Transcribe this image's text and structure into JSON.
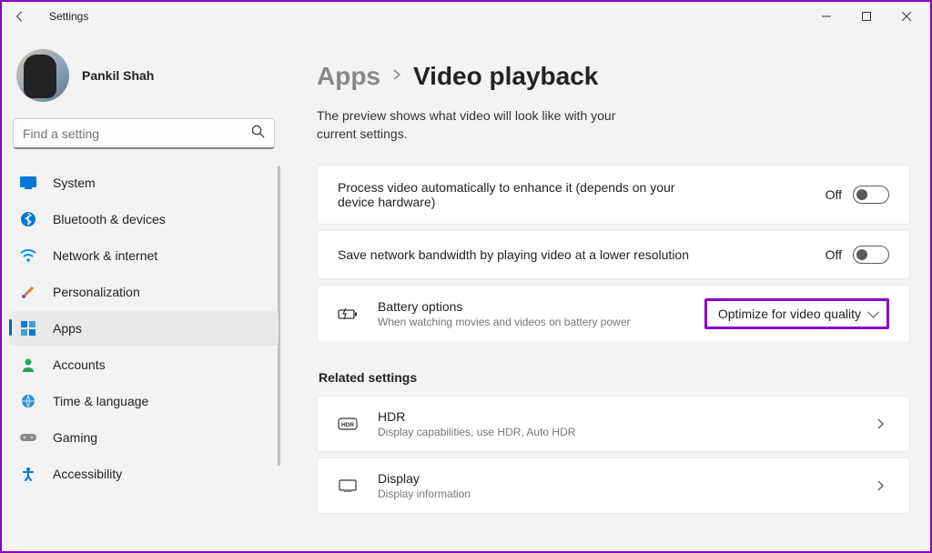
{
  "window": {
    "title": "Settings"
  },
  "profile": {
    "name": "Pankil Shah"
  },
  "search": {
    "placeholder": "Find a setting"
  },
  "nav": {
    "items": [
      {
        "label": "System"
      },
      {
        "label": "Bluetooth & devices"
      },
      {
        "label": "Network & internet"
      },
      {
        "label": "Personalization"
      },
      {
        "label": "Apps"
      },
      {
        "label": "Accounts"
      },
      {
        "label": "Time & language"
      },
      {
        "label": "Gaming"
      },
      {
        "label": "Accessibility"
      }
    ]
  },
  "breadcrumb": {
    "parent": "Apps",
    "current": "Video playback"
  },
  "subtitle": "The preview shows what video will look like with your current settings.",
  "settings": {
    "enhance": {
      "title": "Process video automatically to enhance it (depends on your device hardware)",
      "state": "Off"
    },
    "bandwidth": {
      "title": "Save network bandwidth by playing video at a lower resolution",
      "state": "Off"
    },
    "battery": {
      "title": "Battery options",
      "sub": "When watching movies and videos on battery power",
      "value": "Optimize for video quality"
    }
  },
  "related": {
    "heading": "Related settings",
    "hdr": {
      "title": "HDR",
      "sub": "Display capabilities, use HDR, Auto HDR"
    },
    "display": {
      "title": "Display",
      "sub": "Display information"
    }
  }
}
